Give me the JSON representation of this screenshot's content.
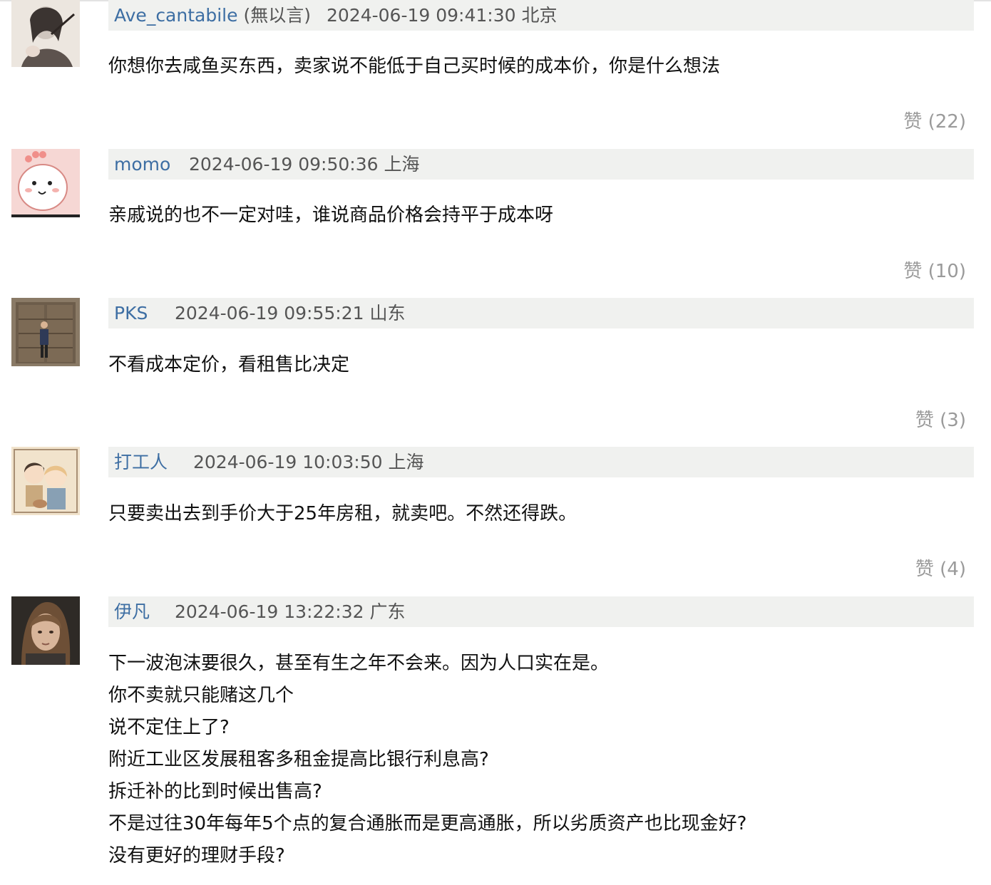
{
  "comments": [
    {
      "username": "Ave_cantabile",
      "nickname": "(無以言)",
      "datetime": "2024-06-19 09:41:30",
      "location": "北京",
      "lines": [
        "你想你去咸鱼买东西，卖家说不能低于自己买时候的成本价，你是什么想法"
      ],
      "like_label": "赞",
      "like_count": "(22)"
    },
    {
      "username": "momo",
      "datetime": "2024-06-19 09:50:36",
      "location": "上海",
      "lines": [
        "亲戚说的也不一定对哇，谁说商品价格会持平于成本呀"
      ],
      "like_label": "赞",
      "like_count": "(10)"
    },
    {
      "username": "PKS",
      "datetime": "2024-06-19 09:55:21",
      "location": "山东",
      "lines": [
        "不看成本定价，看租售比决定"
      ],
      "like_label": "赞",
      "like_count": "(3)"
    },
    {
      "username": "打工人",
      "datetime": "2024-06-19 10:03:50",
      "location": "上海",
      "lines": [
        "只要卖出去到手价大于25年房租，就卖吧。不然还得跌。"
      ],
      "like_label": "赞",
      "like_count": "(4)"
    },
    {
      "username": "伊凡",
      "datetime": "2024-06-19 13:22:32",
      "location": "广东",
      "lines": [
        "下一波泡沫要很久，甚至有生之年不会来。因为人口实在是。",
        "你不卖就只能赌这几个",
        "说不定住上了?",
        "附近工业区发展租客多租金提高比银行利息高?",
        "拆迁补的比到时候出售高?",
        "不是过往30年每年5个点的复合通胀而是更高通胀，所以劣质资产也比现金好?",
        "没有更好的理财手段?"
      ]
    }
  ]
}
